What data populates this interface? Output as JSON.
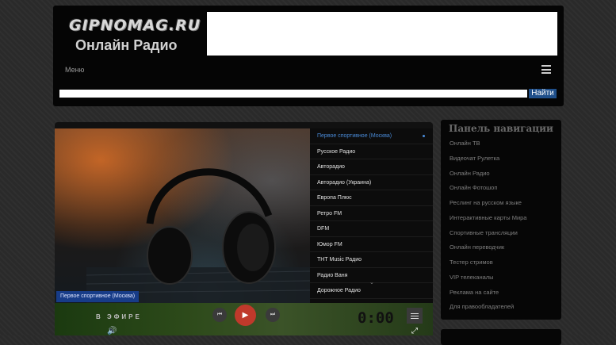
{
  "header": {
    "logo_line1": "GIPNOMAG.RU",
    "logo_line2": "Онлайн Радио",
    "menu_label": "Меню",
    "menu_icon": "hamburger-icon"
  },
  "search": {
    "value": "",
    "placeholder": "",
    "button_label": "Найти"
  },
  "player": {
    "now_playing": "Первое спортивное (Москва)",
    "on_air_label": "В ЭФИРЕ",
    "timer": "0:00",
    "icons": [
      "prev-icon",
      "play-icon",
      "next-icon",
      "list-icon",
      "volume-icon",
      "fullscreen-icon"
    ],
    "accent_color": "#c0392b",
    "stations": [
      {
        "label": "Первое спортивное (Москва)",
        "active": true
      },
      {
        "label": "Русское Радио",
        "active": false
      },
      {
        "label": "Авторадио",
        "active": false
      },
      {
        "label": "Авторадио (Украина)",
        "active": false
      },
      {
        "label": "Европа Плюс",
        "active": false
      },
      {
        "label": "Ретро FM",
        "active": false
      },
      {
        "label": "DFM",
        "active": false
      },
      {
        "label": "Юмор FM",
        "active": false
      },
      {
        "label": "ТНТ Music Радио",
        "active": false
      },
      {
        "label": "Радио Ваня",
        "active": false
      },
      {
        "label": "Дорожное Радио",
        "active": false
      }
    ]
  },
  "nav": {
    "title": "Панель навигации",
    "items": [
      "Онлайн ТВ",
      "Видеочат Рулетка",
      "Онлайн Радио",
      "Онлайн Фотошоп",
      "Реслинг на русском языке",
      "Интерактивные карты Мира",
      "Спортивные трансляции",
      "Онлайн переводчик",
      "Тестер стримов",
      "VIP телеканалы",
      "Реклама на сайте",
      "Для правообладателей"
    ]
  }
}
